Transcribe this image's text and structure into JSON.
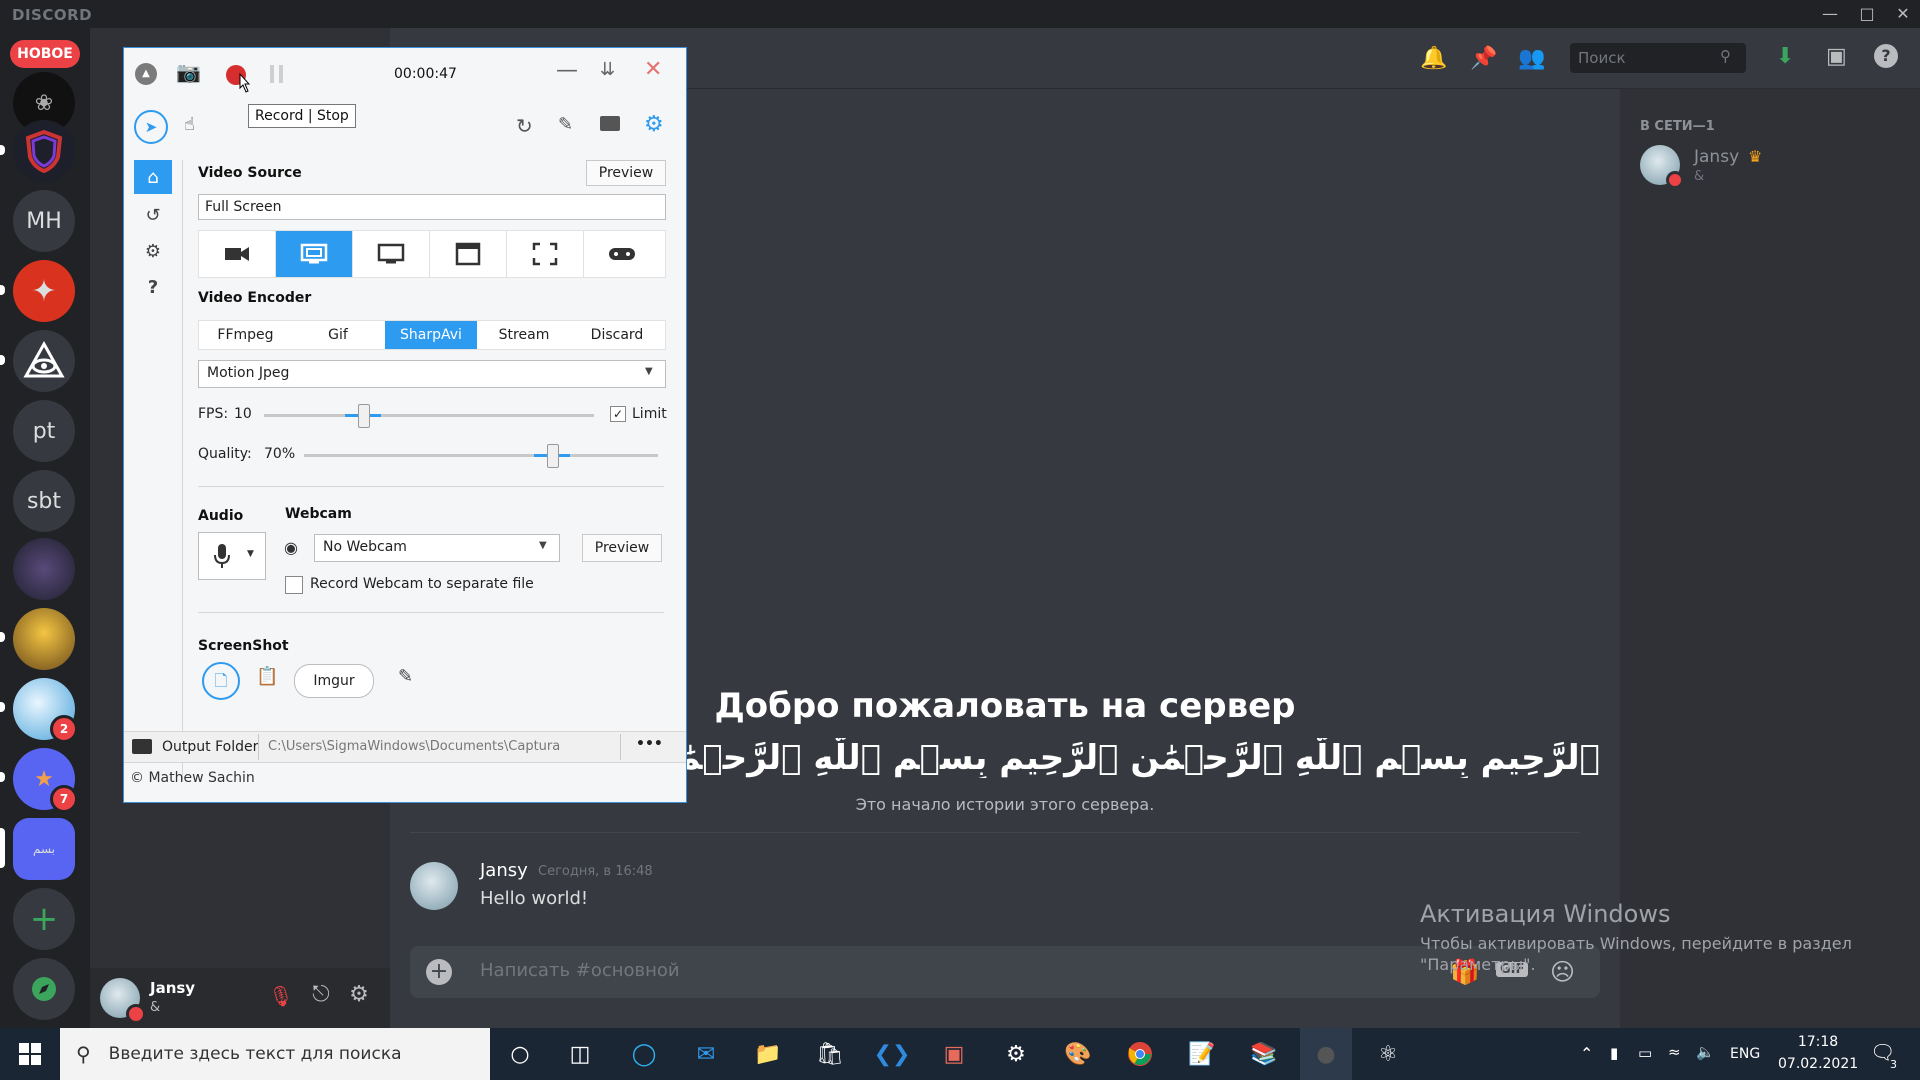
{
  "discord": {
    "brand": "DISCORD",
    "new_badge": "НОВОЕ",
    "servers": [
      {
        "label": "MH"
      },
      {
        "label": "pt"
      },
      {
        "label": "sbt"
      }
    ],
    "server_badges": [
      "2",
      "7"
    ],
    "header": {
      "search_placeholder": "Поиск"
    },
    "members": {
      "heading": "В СЕТИ—1",
      "items": [
        {
          "name": "Jansy",
          "status": "&"
        }
      ]
    },
    "welcome": {
      "title": "Добро пожаловать на сервер",
      "arabic_line": "ٱلرَّحِيمِ بِسۡمِ ٱللَّهِ ٱلرَّحۡمَٰنِ ٱلرَّحِيمِ بِسۡمِ ٱللَّهِ ٱلرَّحۡمَٰنِ ٱلرَّحِيمِ بِسۡمِ ٱللَّهِ ٱلرَّحۡمَٰنِ ٱلرَّحِيمِ بِسۡمِ",
      "history_note": "Это начало истории этого сервера."
    },
    "message": {
      "author": "Jansy",
      "timestamp": "Сегодня, в 16:48",
      "text": "Hello world!"
    },
    "composer": {
      "placeholder": "Написать #основной",
      "gif_label": "GIF"
    },
    "user_panel": {
      "name": "Jansy",
      "status": "&"
    },
    "activation": {
      "title": "Активация Windows",
      "line1": "Чтобы активировать Windows, перейдите в раздел",
      "line2": "\"Параметры\"."
    },
    "colors": {
      "accent": "#5865f2",
      "danger": "#ed4245",
      "online": "#3ba55d"
    }
  },
  "captura": {
    "timer": "00:00:47",
    "tooltip": "Record | Stop",
    "video_source": {
      "label": "Video Source",
      "preview": "Preview",
      "value": "Full Screen",
      "selected_index": 1,
      "sources": [
        "camera-icon",
        "screen-region-icon",
        "monitor-icon",
        "window-icon",
        "fullscreen-icon",
        "gamepad-icon"
      ]
    },
    "video_encoder": {
      "label": "Video Encoder",
      "tabs": [
        "FFmpeg",
        "Gif",
        "SharpAvi",
        "Stream",
        "Discard"
      ],
      "selected": "SharpAvi",
      "codec": "Motion Jpeg"
    },
    "fps": {
      "label": "FPS:",
      "value": "10",
      "level": 0.3,
      "limit_label": "Limit",
      "limit_checked": true
    },
    "quality": {
      "label": "Quality:",
      "value": "70%",
      "level": 0.7
    },
    "audio": {
      "label": "Audio"
    },
    "webcam": {
      "label": "Webcam",
      "value": "No Webcam",
      "preview": "Preview",
      "separate_file": "Record Webcam to separate file"
    },
    "screenshot": {
      "label": "ScreenShot",
      "imgur": "Imgur"
    },
    "output": {
      "label": "Output Folder",
      "path": "C:\\Users\\SigmaWindows\\Documents\\Captura",
      "more": "•••"
    },
    "footer": "© Mathew Sachin"
  },
  "taskbar": {
    "search_placeholder": "Введите здесь текст для поиска",
    "lang": "ENG",
    "time": "17:18",
    "date": "07.02.2021",
    "notifications": "3"
  }
}
